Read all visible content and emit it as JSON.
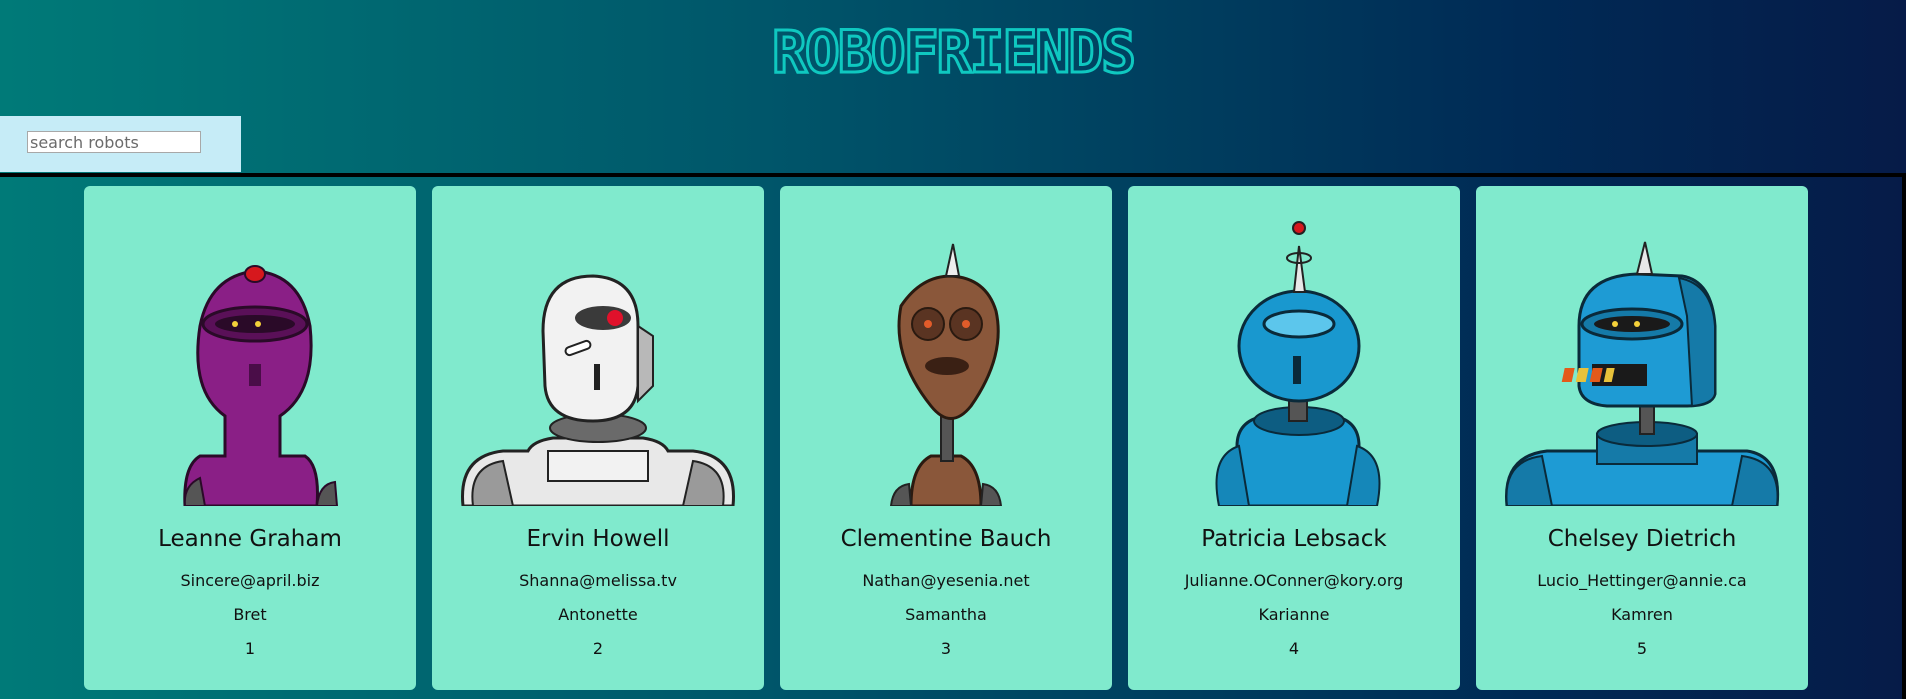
{
  "app": {
    "title": "ROBOFRIENDS",
    "title_color": "#0fc8c0"
  },
  "search": {
    "placeholder": "search robots",
    "value": ""
  },
  "robots": [
    {
      "name": "Leanne Graham",
      "email": "Sincere@april.biz",
      "username": "Bret",
      "id": "1",
      "color": "#8a1f86",
      "accent": "#d6181d"
    },
    {
      "name": "Ervin Howell",
      "email": "Shanna@melissa.tv",
      "username": "Antonette",
      "id": "2",
      "color": "#e8e8e8",
      "accent": "#e0112b"
    },
    {
      "name": "Clementine Bauch",
      "email": "Nathan@yesenia.net",
      "username": "Samantha",
      "id": "3",
      "color": "#8a573a",
      "accent": "#d9d9d9"
    },
    {
      "name": "Patricia Lebsack",
      "email": "Julianne.OConner@kory.org",
      "username": "Karianne",
      "id": "4",
      "color": "#1998cf",
      "accent": "#d6181d"
    },
    {
      "name": "Chelsey Dietrich",
      "email": "Lucio_Hettinger@annie.ca",
      "username": "Kamren",
      "id": "5",
      "color": "#1e9bd4",
      "accent": "#e8c23a"
    }
  ]
}
